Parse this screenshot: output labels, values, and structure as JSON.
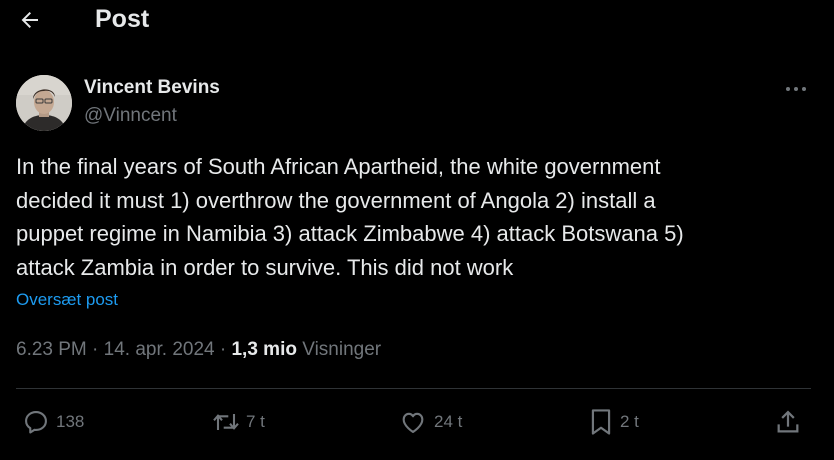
{
  "header": {
    "title": "Post",
    "back_icon": "arrow-left-icon"
  },
  "author": {
    "name": "Vincent Bevins",
    "handle": "@Vinncent"
  },
  "post": {
    "text": "In the final years of South African Apartheid, the white government\ndecided it must 1) overthrow the government of Angola 2) install a\npuppet regime in Namibia 3) attack Zimbabwe 4) attack Botswana 5)\nattack Zambia in order to survive. This did not work",
    "translate_label": "Oversæt post"
  },
  "meta": {
    "time": "6.23 PM",
    "sep1": " · ",
    "date": "14. apr. 2024",
    "sep2": " · ",
    "views_count": "1,3 mio",
    "views_label": " Visninger"
  },
  "actions": {
    "replies": "138",
    "reposts": "7 t",
    "likes": "24 t",
    "bookmarks": "2 t"
  },
  "colors": {
    "background": "#000000",
    "text": "#e7e9ea",
    "secondary": "#71767b",
    "link": "#1d9bf0",
    "divider": "#2f3336"
  }
}
